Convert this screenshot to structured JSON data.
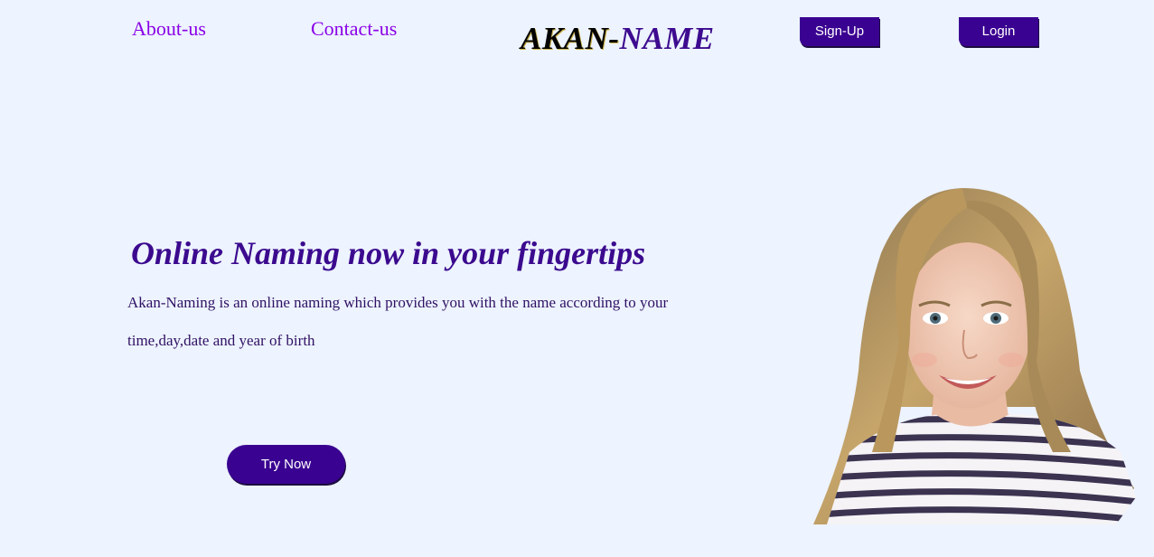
{
  "nav": {
    "about_label": "About-us",
    "contact_label": "Contact-us",
    "brand_part1": "AKAN-",
    "brand_part2": "NAME",
    "signup_label": "Sign-Up",
    "login_label": "Login"
  },
  "hero": {
    "title": "Online Naming now in your fingertips",
    "description": "Akan-Naming is an online naming which provides you with the name according to your time,day,date and year of birth",
    "cta_label": "Try Now"
  },
  "colors": {
    "background": "#edf3ff",
    "accent": "#3a0291",
    "link": "#8a00e6",
    "heading": "#3b0a8e"
  }
}
